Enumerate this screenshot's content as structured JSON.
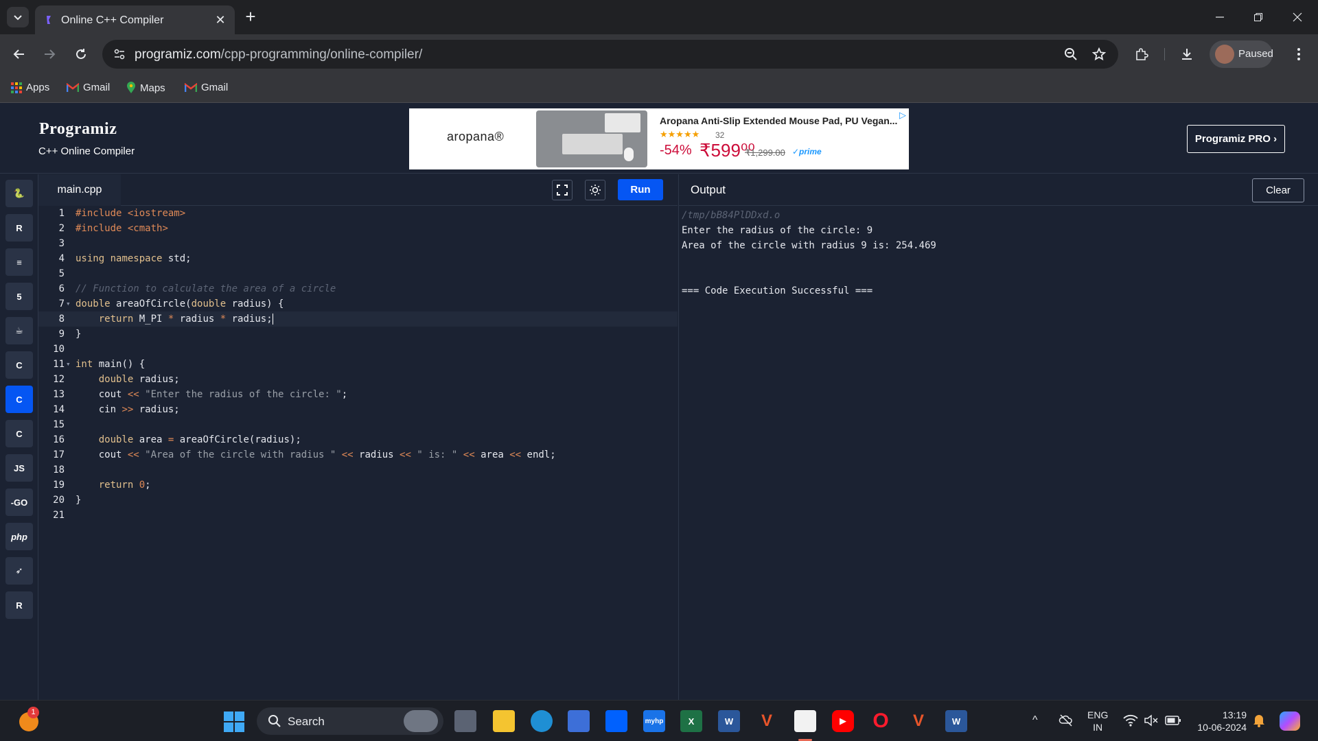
{
  "browser": {
    "tab_title": "Online C++ Compiler",
    "url_host": "programiz.com",
    "url_path": "/cpp-programming/online-compiler/",
    "profile_label": "Paused",
    "bookmarks": [
      "Apps",
      "Gmail",
      "Maps",
      "Gmail"
    ]
  },
  "site": {
    "logo": "Programiz",
    "subtitle": "C++ Online Compiler",
    "pro_button": "Programiz PRO ›"
  },
  "ad": {
    "brand": "aropana®",
    "title": "Aropana Anti-Slip Extended Mouse Pad, PU Vegan...",
    "stars": "★★★★★",
    "rating_count": "32",
    "discount": "-54%",
    "price": "₹599⁰⁰",
    "mrp": "₹1,299.00",
    "prime": "✓prime"
  },
  "languages": [
    {
      "name": "python-icon",
      "label": "🐍",
      "active": false
    },
    {
      "name": "r-icon",
      "label": "R",
      "active": false
    },
    {
      "name": "sql-icon",
      "label": "≡",
      "active": false
    },
    {
      "name": "html-icon",
      "label": "5",
      "active": false
    },
    {
      "name": "java-icon",
      "label": "☕",
      "active": false
    },
    {
      "name": "c-icon",
      "label": "C",
      "active": false
    },
    {
      "name": "cpp-icon",
      "label": "C",
      "active": true
    },
    {
      "name": "csharp-icon",
      "label": "C",
      "active": false
    },
    {
      "name": "js-icon",
      "label": "JS",
      "active": false
    },
    {
      "name": "go-icon",
      "label": "-GO",
      "active": false
    },
    {
      "name": "php-icon",
      "label": "php",
      "active": false
    },
    {
      "name": "swift-icon",
      "label": "➶",
      "active": false
    },
    {
      "name": "rust-icon",
      "label": "R",
      "active": false
    }
  ],
  "editor": {
    "file_name": "main.cpp",
    "run_label": "Run",
    "line_numbers": [
      "1",
      "2",
      "3",
      "4",
      "5",
      "6",
      "7",
      "8",
      "9",
      "10",
      "11",
      "12",
      "13",
      "14",
      "15",
      "16",
      "17",
      "18",
      "19",
      "20",
      "21"
    ],
    "lines": [
      "#include <iostream>",
      "#include <cmath>",
      "",
      "using namespace std;",
      "",
      "// Function to calculate the area of a circle",
      "double areaOfCircle(double radius) {",
      "    return M_PI * radius * radius;",
      "}",
      "",
      "int main() {",
      "    double radius;",
      "    cout << \"Enter the radius of the circle: \";",
      "    cin >> radius;",
      "",
      "    double area = areaOfCircle(radius);",
      "    cout << \"Area of the circle with radius \" << radius << \" is: \" << area << endl;",
      "",
      "    return 0;",
      "}",
      ""
    ]
  },
  "output": {
    "title": "Output",
    "clear_label": "Clear",
    "lines": [
      "/tmp/bB84PlDDxd.o",
      "Enter the radius of the circle: 9",
      "Area of the circle with radius 9 is: 254.469",
      "",
      "",
      "=== Code Execution Successful ==="
    ]
  },
  "taskbar": {
    "weather_badge": "1",
    "search_label": "Search",
    "lang_line1": "ENG",
    "lang_line2": "IN",
    "time": "13:19",
    "date": "10-06-2024"
  }
}
